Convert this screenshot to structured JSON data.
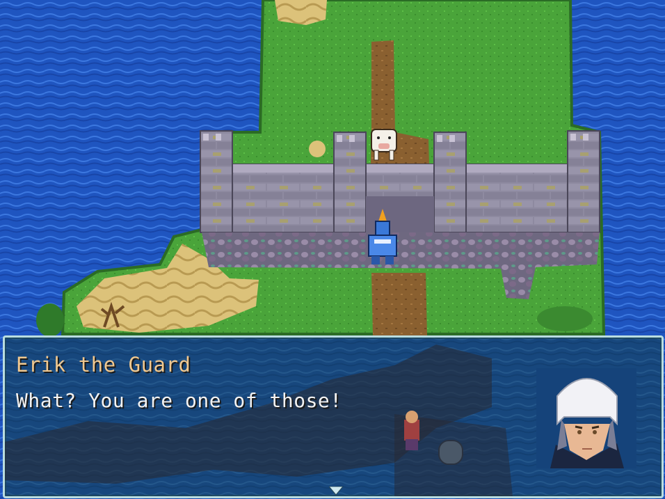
{
  "dialog": {
    "speaker": "Erik the Guard",
    "text": "What? You are one of those!"
  },
  "characters": {
    "player": "hero-sprite",
    "npc": "cow-sprite",
    "portrait": "erik-portrait"
  },
  "colors": {
    "water": "#1f55c0",
    "grass": "#4aa43a",
    "dirt": "#8a6030",
    "sand": "#dcc27a",
    "stone": "#8e8aa0",
    "dialog_border": "#b9dde0",
    "speaker_text": "#f0c890"
  }
}
